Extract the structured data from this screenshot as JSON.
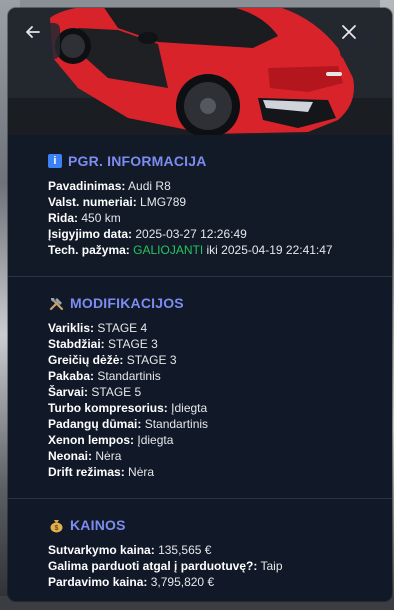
{
  "header": {
    "back_label": "",
    "close_label": ""
  },
  "info": {
    "title": "PGR. INFORMACIJA",
    "icon": "info-icon",
    "name_label": "Pavadinimas:",
    "name_value": "Audi R8",
    "plate_label": "Valst. numeriai:",
    "plate_value": "LMG789",
    "mileage_label": "Rida:",
    "mileage_value": "450 km",
    "purchase_label": "Įsigyjimo data:",
    "purchase_value": "2025-03-27 12:26:49",
    "tech_label": "Tech. pažyma:",
    "tech_status": "GALIOJANTI",
    "tech_until": "iki 2025-04-19 22:41:47"
  },
  "mods": {
    "title": "MODIFIKACIJOS",
    "icon": "tools-icon",
    "items": [
      {
        "label": "Variklis:",
        "value": "STAGE 4"
      },
      {
        "label": "Stabdžiai:",
        "value": "STAGE 3"
      },
      {
        "label": "Greičių dėžė:",
        "value": "STAGE 3"
      },
      {
        "label": "Pakaba:",
        "value": "Standartinis"
      },
      {
        "label": "Šarvai:",
        "value": "STAGE 5"
      },
      {
        "label": "Turbo kompresorius:",
        "value": "Įdiegta"
      },
      {
        "label": "Padangų dūmai:",
        "value": "Standartinis"
      },
      {
        "label": "Xenon lempos:",
        "value": "Įdiegta"
      },
      {
        "label": "Neonai:",
        "value": "Nėra"
      },
      {
        "label": "Drift režimas:",
        "value": "Nėra"
      }
    ]
  },
  "prices": {
    "title": "KAINOS",
    "icon": "money-bag-icon",
    "repair_label": "Sutvarkymo kaina:",
    "repair_value": "135,565 €",
    "sellback_label": "Galima parduoti atgal į parduotuvę?:",
    "sellback_value": "Taip",
    "sale_label": "Pardavimo kaina:",
    "sale_value": "3,795,820 €"
  },
  "colors": {
    "accent": "#7c8cf0",
    "valid": "#22c55e",
    "panel": "#111827",
    "car": "#e0262b"
  }
}
